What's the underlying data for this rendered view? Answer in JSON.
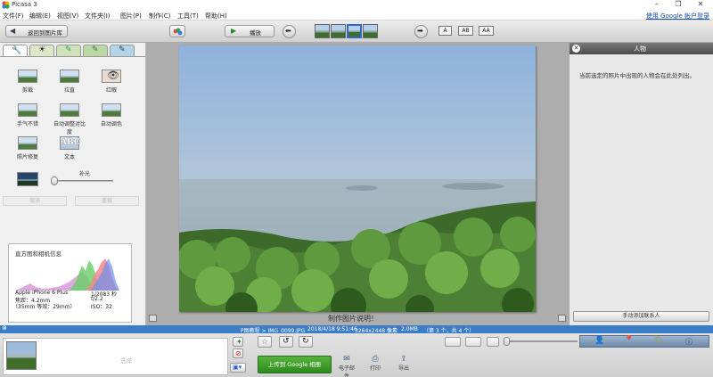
{
  "window": {
    "title": "Picasa 3"
  },
  "menu": {
    "items": [
      "文件(F)",
      "编辑(E)",
      "视图(V)",
      "文件夹(I)",
      "图片(P)",
      "制作(C)",
      "工具(T)",
      "帮助(H)"
    ],
    "google_login": "使用 Google 帐户登录"
  },
  "toolbar": {
    "back_label": "返回到图片库",
    "play_label": "播放",
    "text_modes": [
      "A",
      "AB",
      "AA"
    ]
  },
  "edit_panel": {
    "tools": [
      {
        "label": "剪裁",
        "icon": "crop-icon"
      },
      {
        "label": "拉直",
        "icon": "straighten-icon"
      },
      {
        "label": "红眼",
        "icon": "red-eye-icon"
      },
      {
        "label": "手气不错",
        "icon": "feeling-lucky-icon"
      },
      {
        "label": "自动调整对比度",
        "icon": "auto-contrast-icon"
      },
      {
        "label": "自动调色",
        "icon": "auto-color-icon"
      },
      {
        "label": "照片修复",
        "icon": "retouch-icon"
      },
      {
        "label": "文本",
        "icon": "text-icon"
      }
    ],
    "fill_light_label": "补光",
    "fill_light_value": 0,
    "undo_label": "撤消",
    "redo_label": "重做"
  },
  "camera_info": {
    "heading": "直方图和相机信息",
    "model": "Apple iPhone 6 Plus",
    "focal": "焦距：4.2mm",
    "equiv": "（35mm 等效：29mm）",
    "exposure": "1/2083 秒",
    "aperture": "f/2.2",
    "iso": "ISO：32"
  },
  "main": {
    "caption_placeholder": "制作图片说明！"
  },
  "people_panel": {
    "title": "人物",
    "description": "当前选定的照片中出现的人物会在此处列出。",
    "add_button": "手动添加联系人"
  },
  "status": {
    "path": "P图教程 > IMG_0099.JPG",
    "datetime": "2018/4/18 9:51:46",
    "dimensions": "3264x2448 像素",
    "size": "2.0MB",
    "position": "（第 3 个，共 4 个）"
  },
  "bottom": {
    "select_label": "选择",
    "upload_label": "上传到 Google 相册",
    "actions": [
      "电子邮件",
      "打印",
      "导出"
    ]
  },
  "colors": {
    "status_bar": "#3c7dc8",
    "upload_green": "#3f9a2c",
    "link": "#1a4fb0"
  }
}
